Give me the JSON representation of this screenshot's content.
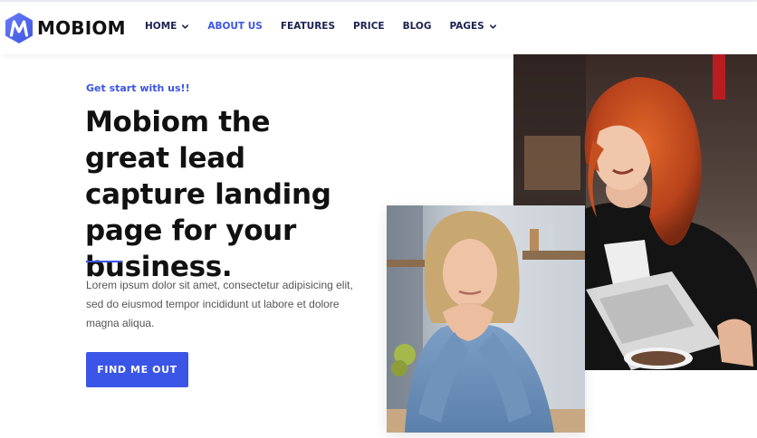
{
  "brand": {
    "name": "MOBIOM",
    "color": "#3b55e6"
  },
  "nav": {
    "items": [
      {
        "label": "HOME",
        "has_dropdown": true
      },
      {
        "label": "ABOUT US",
        "active": true
      },
      {
        "label": "FEATURES"
      },
      {
        "label": "PRICE"
      },
      {
        "label": "BLOG"
      },
      {
        "label": "PAGES",
        "has_dropdown": true
      }
    ]
  },
  "hero": {
    "eyebrow": "Get start with us!!",
    "headline": "Mobiom the great lead capture landing page for your business.",
    "body": "Lorem ipsum dolor sit amet, consectetur adipisicing elit, sed do eiusmod tempor incididunt ut labore et dolore magna aliqua.",
    "cta_label": "FIND ME OUT"
  },
  "images": {
    "back": "photo-red-haired-woman-with-laptop",
    "front": "photo-blonde-woman-denim-shirt"
  },
  "icons": {
    "logo": "m-logo-icon",
    "dropdown": "chevron-down-icon"
  }
}
